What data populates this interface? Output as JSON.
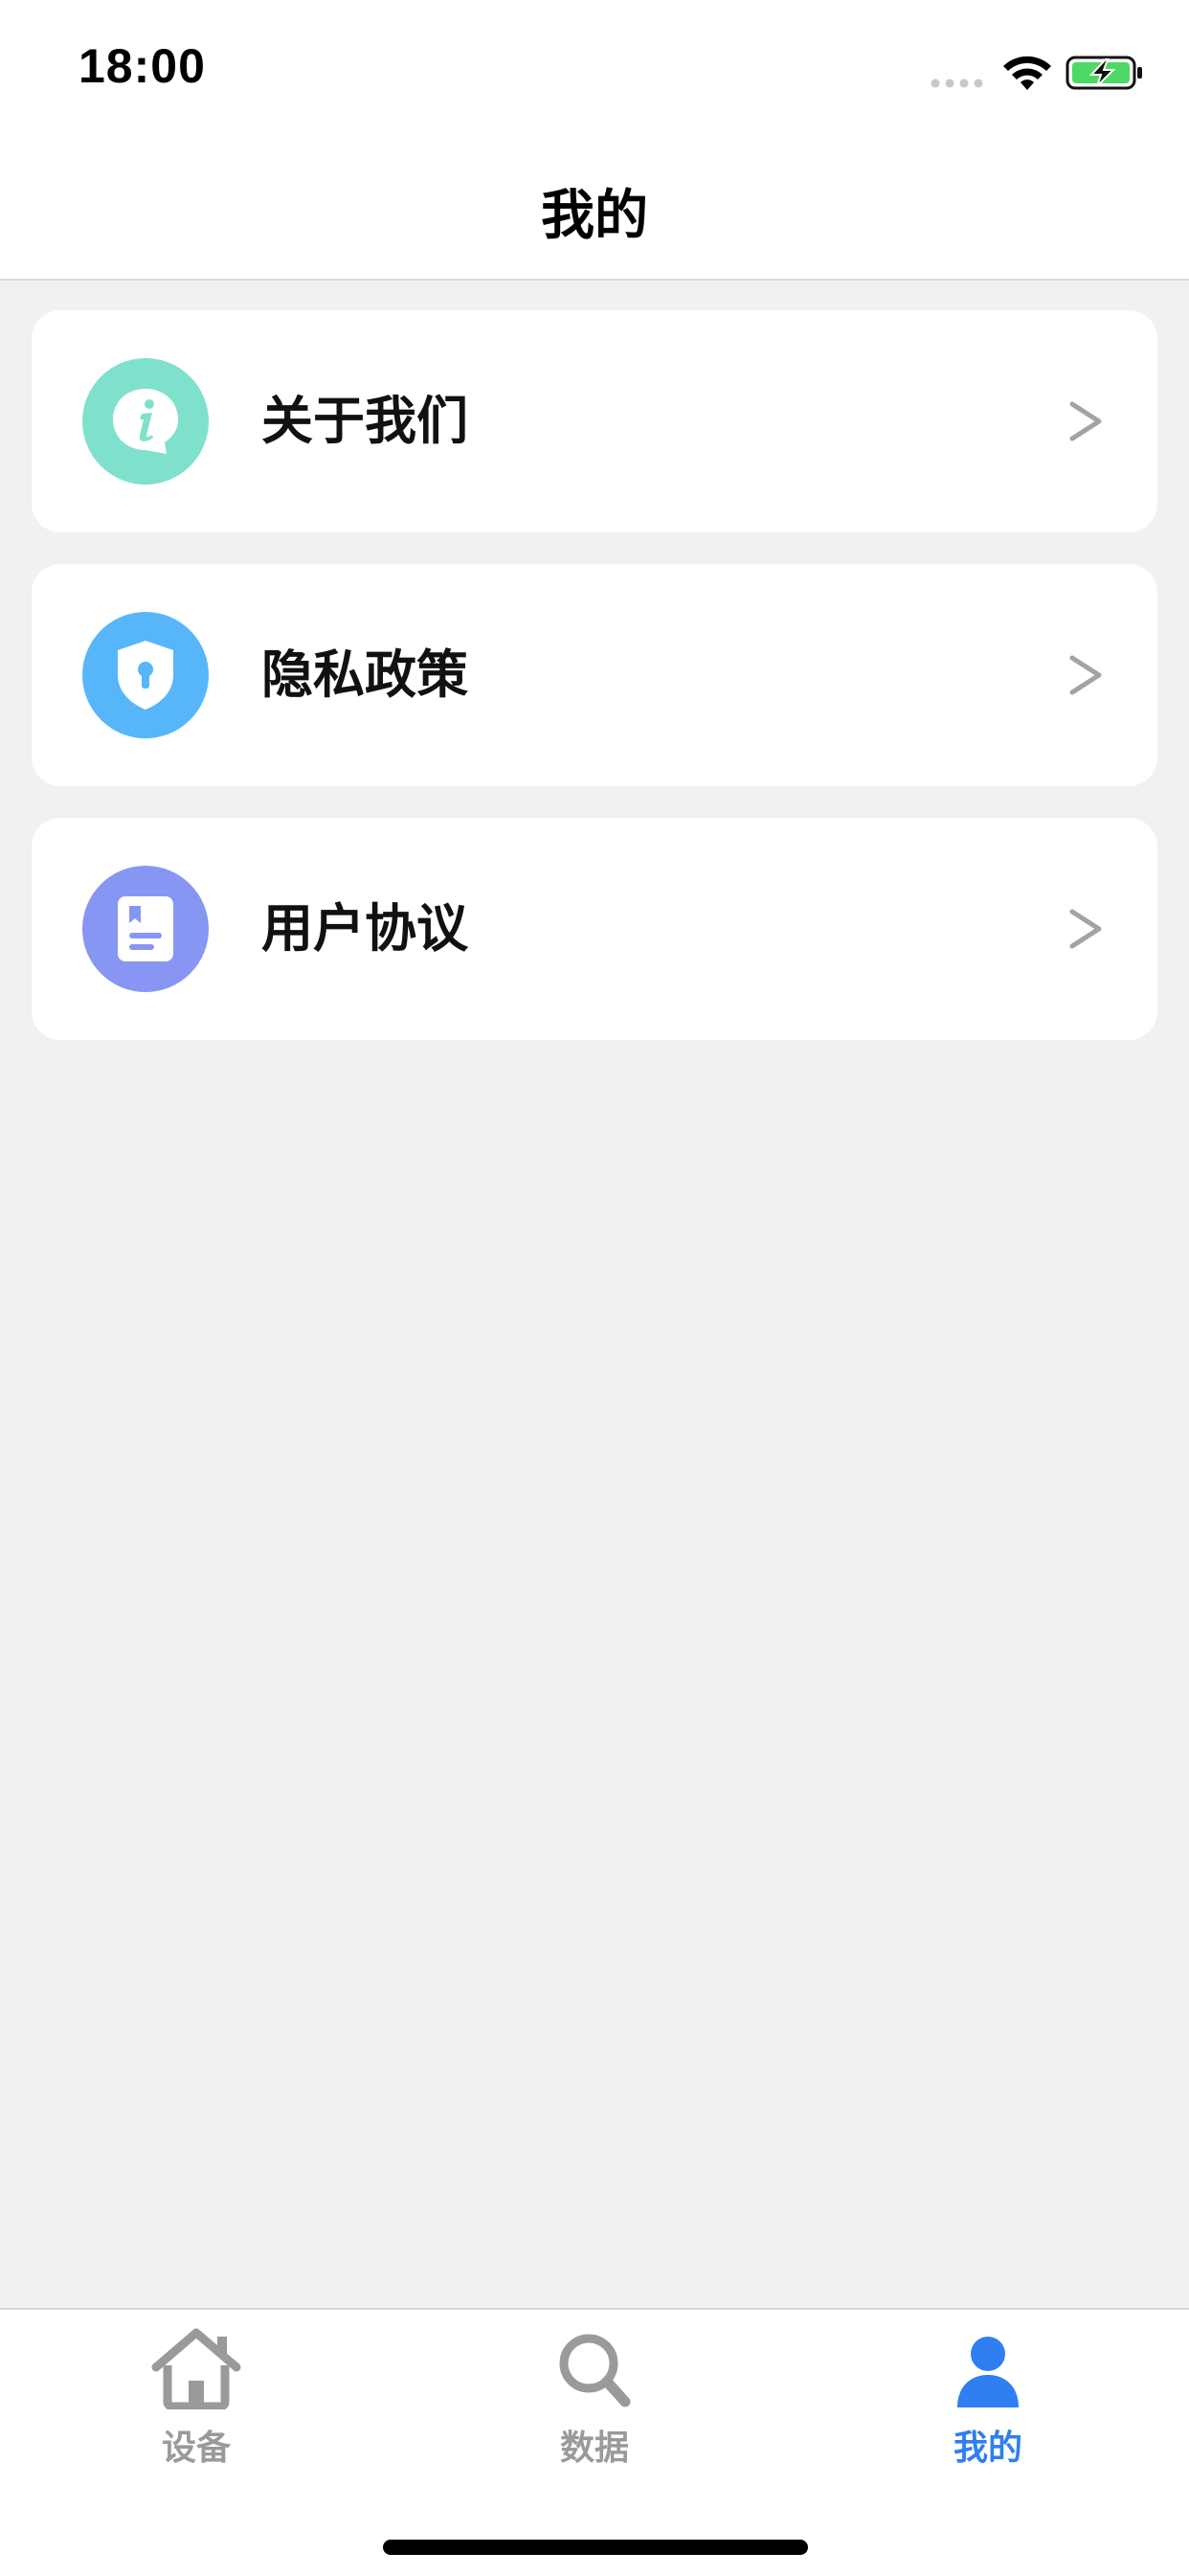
{
  "status_bar": {
    "time": "18:00",
    "icons": [
      "signal-dots-icon",
      "wifi-icon",
      "battery-charging-icon"
    ],
    "battery_color": "#4cd964"
  },
  "nav": {
    "title": "我的"
  },
  "menu": {
    "items": [
      {
        "label": "关于我们",
        "icon": "info-icon",
        "icon_bg": "#7fe1cc",
        "chevron": ">"
      },
      {
        "label": "隐私政策",
        "icon": "shield-lock-icon",
        "icon_bg": "#56b6f9",
        "chevron": ">"
      },
      {
        "label": "用户协议",
        "icon": "document-icon",
        "icon_bg": "#8796f3",
        "chevron": ">"
      }
    ]
  },
  "tab_bar": {
    "tabs": [
      {
        "label": "设备",
        "icon": "home-icon",
        "active": false
      },
      {
        "label": "数据",
        "icon": "search-icon",
        "active": false
      },
      {
        "label": "我的",
        "icon": "person-icon",
        "active": true
      }
    ],
    "active_color": "#2f7ff0",
    "inactive_color": "#9a9a9a"
  }
}
